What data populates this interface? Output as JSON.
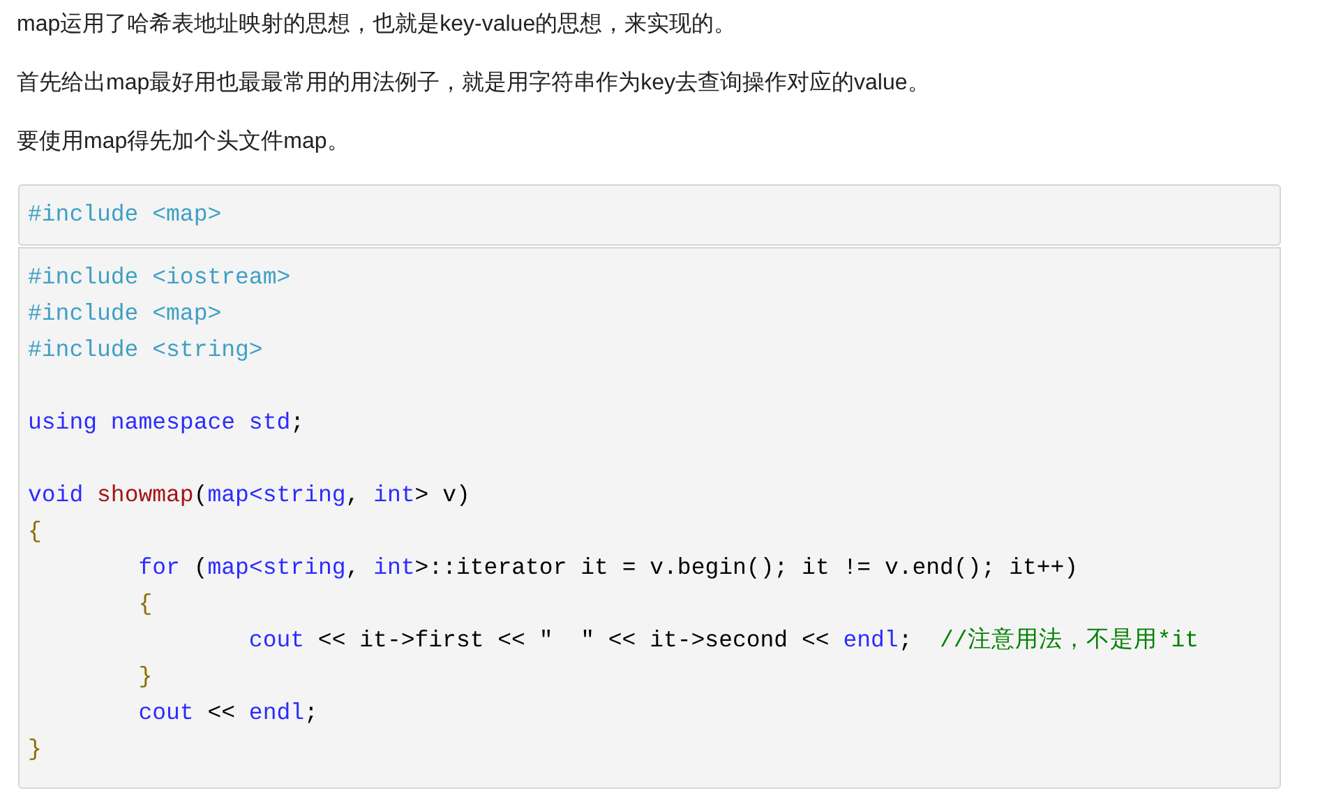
{
  "paragraphs": [
    "map运用了哈希表地址映射的思想，也就是key-value的思想，来实现的。",
    "首先给出map最好用也最最常用的用法例子，就是用字符串作为key去查询操作对应的value。",
    "要使用map得先加个头文件map。"
  ],
  "code_blocks": [
    {
      "lines": [
        {
          "tokens": [
            {
              "kind": "preproc",
              "text": "#include <map>"
            }
          ]
        }
      ]
    },
    {
      "lines": [
        {
          "tokens": [
            {
              "kind": "preproc",
              "text": "#include <iostream>"
            }
          ]
        },
        {
          "tokens": [
            {
              "kind": "preproc",
              "text": "#include <map>"
            }
          ]
        },
        {
          "tokens": [
            {
              "kind": "preproc",
              "text": "#include <string>"
            }
          ]
        },
        {
          "blank_before": true,
          "tokens": [
            {
              "kind": "keyword",
              "text": "using namespace std"
            },
            {
              "kind": "plain",
              "text": ";"
            }
          ]
        },
        {
          "blank_before": true,
          "tokens": [
            {
              "kind": "keyword",
              "text": "void "
            },
            {
              "kind": "function",
              "text": "showmap"
            },
            {
              "kind": "plain",
              "text": "("
            },
            {
              "kind": "keyword",
              "text": "map<string"
            },
            {
              "kind": "plain",
              "text": ", "
            },
            {
              "kind": "keyword",
              "text": "int"
            },
            {
              "kind": "plain",
              "text": "> v)"
            }
          ]
        },
        {
          "tokens": [
            {
              "kind": "brace",
              "text": "{"
            }
          ],
          "children": [
            {
              "tokens": [
                {
                  "kind": "keyword",
                  "text": "for"
                },
                {
                  "kind": "plain",
                  "text": " ("
                },
                {
                  "kind": "keyword",
                  "text": "map<string"
                },
                {
                  "kind": "plain",
                  "text": ", "
                },
                {
                  "kind": "keyword",
                  "text": "int"
                },
                {
                  "kind": "plain",
                  "text": ">::iterator it = v.begin(); it != v.end(); it++)"
                }
              ]
            },
            {
              "tokens": [
                {
                  "kind": "brace",
                  "text": "{"
                }
              ],
              "children": [
                {
                  "tokens": [
                    {
                      "kind": "keyword",
                      "text": "cout"
                    },
                    {
                      "kind": "plain",
                      "text": " << it->first << \"  \" << it->second << "
                    },
                    {
                      "kind": "keyword",
                      "text": "endl"
                    },
                    {
                      "kind": "plain",
                      "text": ";  "
                    },
                    {
                      "kind": "comment",
                      "text": "//注意用法，不是用*it"
                    }
                  ]
                }
              ]
            },
            {
              "tokens": [
                {
                  "kind": "brace",
                  "text": "}"
                }
              ]
            },
            {
              "tokens": [
                {
                  "kind": "keyword",
                  "text": "cout"
                },
                {
                  "kind": "plain",
                  "text": " << "
                },
                {
                  "kind": "keyword",
                  "text": "endl"
                },
                {
                  "kind": "plain",
                  "text": ";"
                }
              ]
            }
          ]
        },
        {
          "tokens": [
            {
              "kind": "brace",
              "text": "}"
            }
          ]
        }
      ]
    }
  ]
}
